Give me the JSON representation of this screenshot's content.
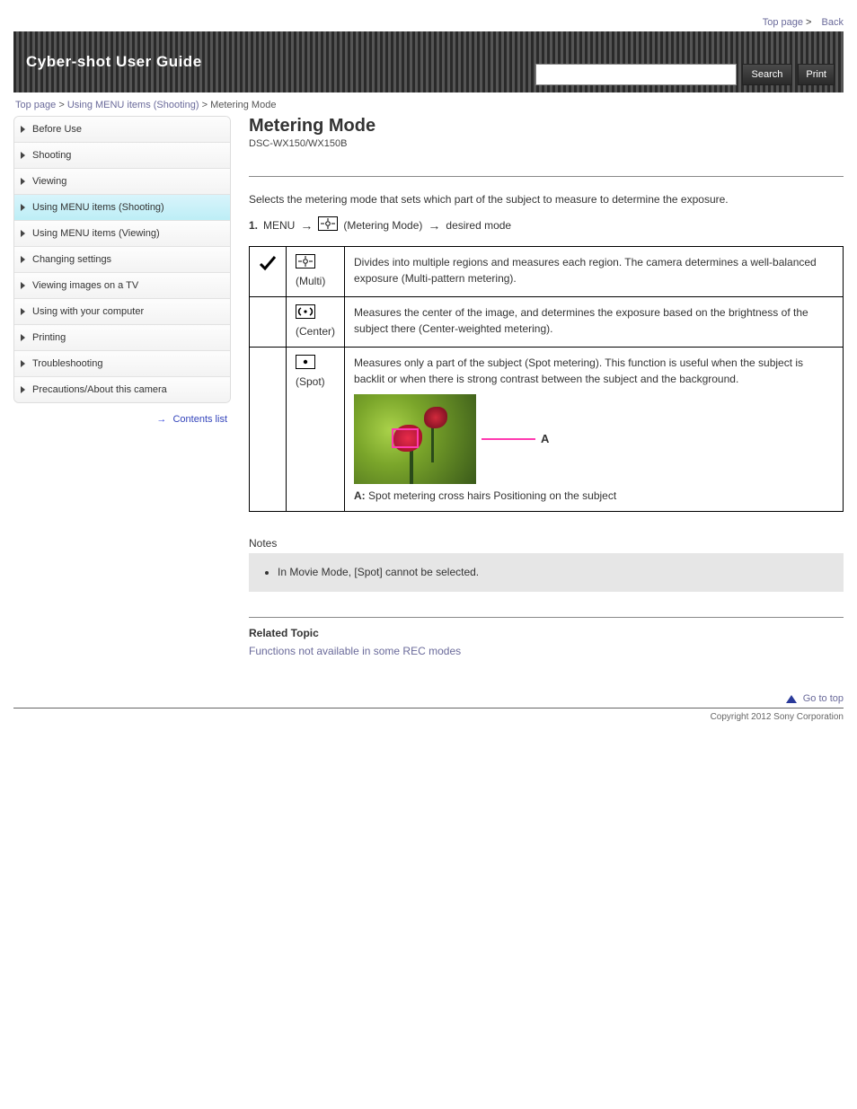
{
  "top_links": {
    "top": "Top page",
    "back": "Back"
  },
  "header": {
    "title": "Cyber-shot User Guide",
    "search_placeholder": "",
    "search_btn": "Search",
    "print_btn": "Print"
  },
  "breadcrumb": {
    "a": "Top page",
    "b": "Using MENU items (Shooting)",
    "c": "Metering Mode"
  },
  "sidebar": {
    "items": [
      {
        "label": "Before Use"
      },
      {
        "label": "Shooting"
      },
      {
        "label": "Viewing"
      },
      {
        "label": "Using MENU items (Shooting)"
      },
      {
        "label": "Using MENU items (Viewing)"
      },
      {
        "label": "Changing settings"
      },
      {
        "label": "Viewing images on a TV"
      },
      {
        "label": "Using with your computer"
      },
      {
        "label": "Printing"
      },
      {
        "label": "Troubleshooting"
      },
      {
        "label": "Precautions/About this camera"
      }
    ],
    "back": "Contents list"
  },
  "main": {
    "title": "Metering Mode",
    "sub": "DSC-WX150/WX150B",
    "desc": "Selects the metering mode that sets which part of the subject to measure to determine the exposure.",
    "step_prefix": "MENU",
    "path_label": "(Metering Mode)",
    "step_suffix": "desired mode",
    "options": [
      {
        "icon": "multi",
        "name": "(Multi)",
        "desc": "Divides into multiple regions and measures each region. The camera determines a well-balanced exposure (Multi-pattern metering)."
      },
      {
        "icon": "center",
        "name": "(Center)",
        "desc": "Measures the center of the image, and determines the exposure based on the brightness of the subject there (Center-weighted metering)."
      },
      {
        "icon": "spot",
        "name": "(Spot)",
        "desc_before": "Measures only a part of the subject (Spot metering). This function is useful when the subject is backlit or when there is strong contrast between the subject and the background.",
        "callout_label": "A",
        "desc_after_label": "A:",
        "desc_after": " Spot metering cross hairs  Positioning on the subject"
      }
    ],
    "notes_head": "Notes",
    "notes": [
      "In Movie Mode, [Spot] cannot be selected."
    ],
    "related_head": "Related Topic",
    "related_link": "Functions not available in some REC modes",
    "go_top": "Go to top"
  },
  "copyright": "Copyright 2012 Sony Corporation"
}
